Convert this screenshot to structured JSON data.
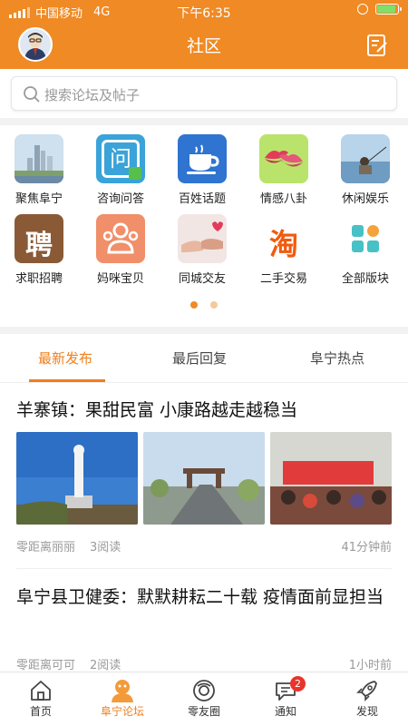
{
  "status_bar": {
    "carrier": "中国移动",
    "network": "4G",
    "time": "下午6:35"
  },
  "header": {
    "title": "社区"
  },
  "search": {
    "placeholder": "搜索论坛及帖子"
  },
  "categories": [
    {
      "label": "聚焦阜宁",
      "icon": "city-photo-icon"
    },
    {
      "label": "咨询问答",
      "icon": "question-icon"
    },
    {
      "label": "百姓话题",
      "icon": "coffee-cup-icon"
    },
    {
      "label": "情感八卦",
      "icon": "lips-icon"
    },
    {
      "label": "休闲娱乐",
      "icon": "fishing-photo-icon"
    },
    {
      "label": "求职招聘",
      "icon": "hire-icon"
    },
    {
      "label": "妈咪宝贝",
      "icon": "family-icon"
    },
    {
      "label": "同城交友",
      "icon": "hands-photo-icon"
    },
    {
      "label": "二手交易",
      "icon": "taobao-icon"
    },
    {
      "label": "全部版块",
      "icon": "grid-icon"
    }
  ],
  "tiles": {
    "ask": "问",
    "hire": "聘",
    "trade": "淘"
  },
  "tabs": [
    "最新发布",
    "最后回复",
    "阜宁热点"
  ],
  "posts": [
    {
      "title": "羊寨镇：果甜民富 小康路越走越稳当",
      "author": "零距离丽丽",
      "reads": "3阅读",
      "time": "41分钟前"
    },
    {
      "title": "阜宁县卫健委：默默耕耘二十载 疫情面前显担当",
      "author": "零距离可可",
      "reads": "2阅读",
      "time": "1小时前"
    }
  ],
  "bottom_nav": [
    {
      "label": "首页",
      "icon": "home-icon"
    },
    {
      "label": "阜宁论坛",
      "icon": "forum-icon"
    },
    {
      "label": "零友圈",
      "icon": "circle-icon"
    },
    {
      "label": "通知",
      "icon": "bell-message-icon",
      "badge": "2"
    },
    {
      "label": "发现",
      "icon": "rocket-icon"
    }
  ],
  "colors": {
    "brand": "#f08a24",
    "accent": "#ee7f1e",
    "badge": "#e8352b"
  }
}
